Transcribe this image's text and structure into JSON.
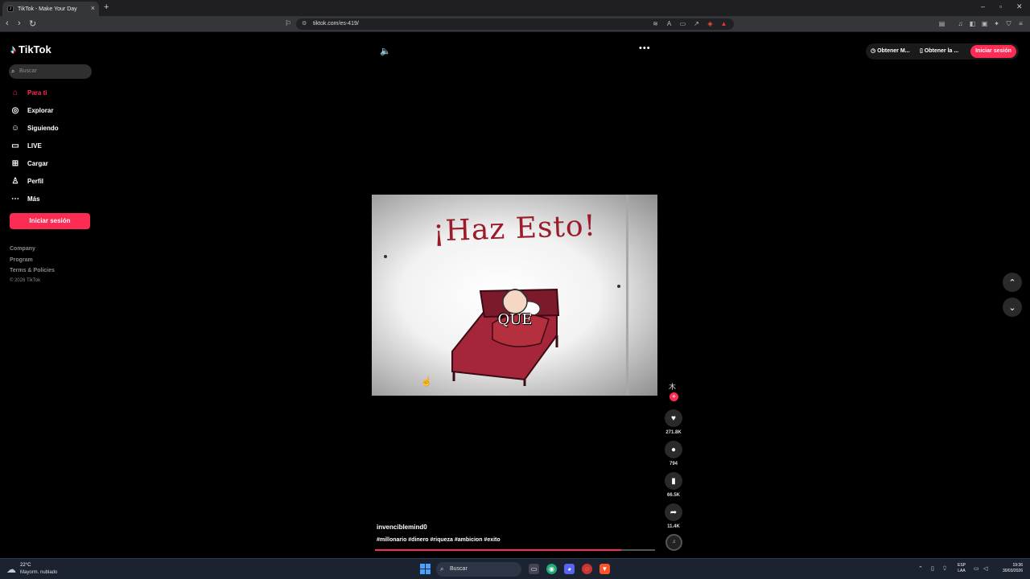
{
  "browser": {
    "tab_title": "TikTok - Make Your Day",
    "tab_close": "×",
    "new_tab": "+",
    "url": "tiktok.com/es-419/"
  },
  "sidebar": {
    "logo": "TikTok",
    "search_placeholder": "Buscar",
    "items": [
      {
        "label": "Para ti",
        "icon": "home-icon"
      },
      {
        "label": "Explorar",
        "icon": "compass-icon"
      },
      {
        "label": "Siguiendo",
        "icon": "following-icon"
      },
      {
        "label": "LIVE",
        "icon": "live-icon"
      },
      {
        "label": "Cargar",
        "icon": "upload-icon"
      },
      {
        "label": "Perfil",
        "icon": "profile-icon"
      },
      {
        "label": "Más",
        "icon": "more-dots-icon"
      }
    ],
    "login_label": "Iniciar sesión",
    "footer": [
      "Company",
      "Program",
      "Terms & Policies"
    ],
    "copyright": "© 2026 TikTok"
  },
  "header": {
    "get_app_1": "Obtener M...",
    "get_app_2": "Obtener la ...",
    "login_label": "Iniciar sesión"
  },
  "video": {
    "title_text": "¡Haz Esto!",
    "caption": "QUE",
    "author": "invenciblemind0",
    "hashtags": "#millonario #dinero #riqueza #ambicion #exito",
    "progress": 0.88
  },
  "actions": {
    "likes": "271.8K",
    "comments": "794",
    "saves": "66.5K",
    "shares": "11.4K"
  },
  "taskbar": {
    "temperature": "22°C",
    "weather": "Mayorm. nublado",
    "search": "Buscar",
    "lang_1": "ESP",
    "lang_2": "LAA",
    "time": "19:36",
    "date": "30/03/2026"
  },
  "colors": {
    "accent": "#fe2c55",
    "background": "#000000"
  }
}
